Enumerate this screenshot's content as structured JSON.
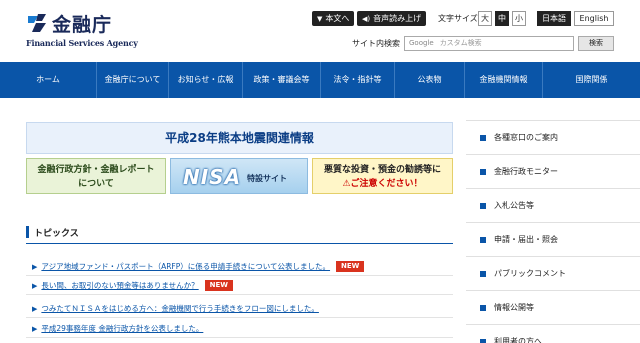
{
  "header": {
    "logo_jp": "金融庁",
    "logo_en": "Financial Services Agency",
    "main_text_btn": "本文へ",
    "audio_btn": "音声読み上げ",
    "font_size_label": "文字サイズ",
    "font_sizes": [
      "大",
      "中",
      "小"
    ],
    "lang_ja": "日本語",
    "lang_en": "English",
    "search_label": "サイト内検索",
    "search_google": "Google",
    "search_placeholder": "カスタム検索",
    "search_button": "検索",
    "colors": {
      "brand": "#1a2a5a",
      "nav": "#0a55a8"
    }
  },
  "nav": {
    "items": [
      "ホーム",
      "金融庁について",
      "お知らせ・広報",
      "政策・審議会等",
      "法令・指針等",
      "公表物",
      "金融機関情報",
      "国際関係"
    ]
  },
  "main": {
    "banner_title": "平成28年熊本地震関連情報",
    "banner1_line1": "金融行政方針・金融レポート",
    "banner1_line2": "について",
    "banner2_nisa": "NISA",
    "banner2_sub": "特設サイト",
    "banner3_line1": "悪質な投資・預金の勧誘等に",
    "banner3_line2": "ご注意ください！",
    "topics_title": "トピックス",
    "topics": [
      {
        "text": "アジア地域ファンド・パスポート（ARFP）に係る申請手続きについて公表しました。",
        "badge": "NEW"
      },
      {
        "text": "長い間、お取引のない預金等はありませんか？",
        "badge": "NEW"
      },
      {
        "text": "つみたてＮＩＳＡをはじめる方へ：金融機関で行う手続きをフロー図にしました。",
        "badge": ""
      },
      {
        "text": "平成29事務年度 金融行政方針を公表しました。",
        "badge": ""
      }
    ]
  },
  "sidebar": {
    "items": [
      "各種窓口のご案内",
      "金融行政モニター",
      "入札公告等",
      "申請・届出・照会",
      "パブリックコメント",
      "情報公開等",
      "利用者の方へ"
    ]
  }
}
